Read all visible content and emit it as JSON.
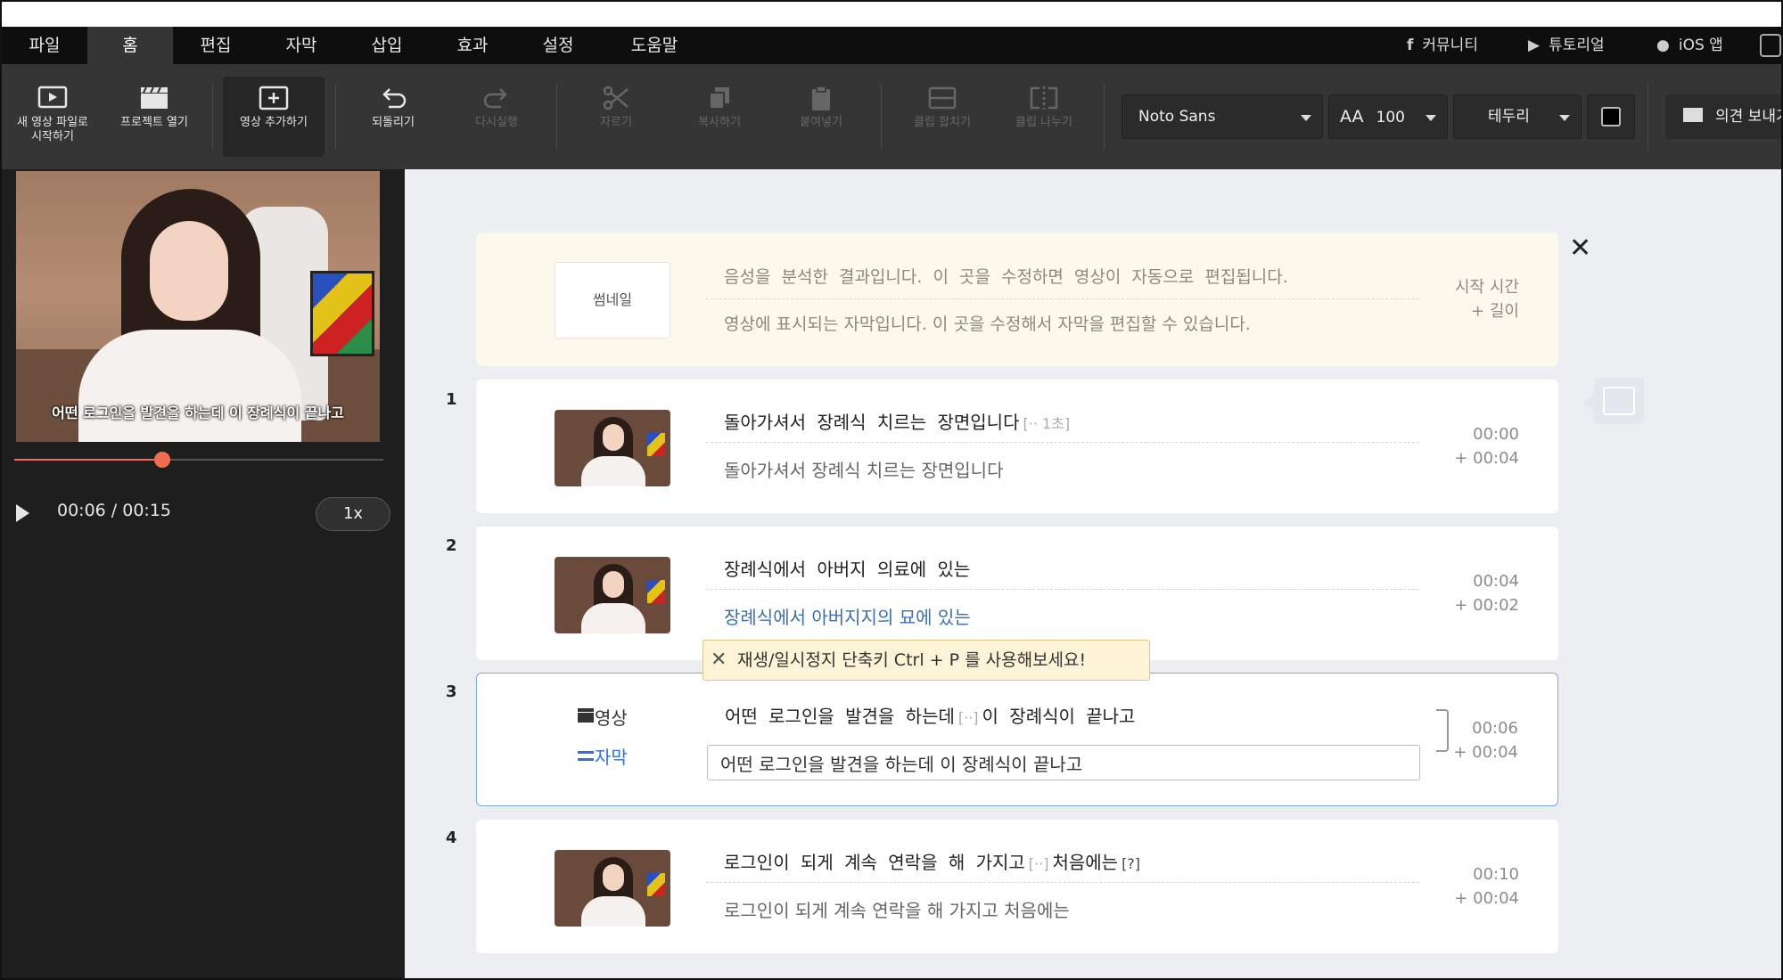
{
  "menu": {
    "tabs": [
      "파일",
      "홈",
      "편집",
      "자막",
      "삽입",
      "효과",
      "설정",
      "도움말"
    ],
    "active_index": 1,
    "links": [
      {
        "icon": "facebook-icon",
        "label": "커뮤니티"
      },
      {
        "icon": "youtube-icon",
        "label": "튜토리얼"
      },
      {
        "icon": "apple-icon",
        "label": "iOS 앱"
      }
    ]
  },
  "toolbar": {
    "buttons": [
      {
        "icon": "new-video-icon",
        "label": "새 영상 파일로\n시작하기",
        "enabled": true
      },
      {
        "icon": "clapperboard-icon",
        "label": "프로젝트 열기",
        "enabled": true
      },
      {
        "icon": "add-video-icon",
        "label": "영상 추가하기",
        "enabled": true,
        "active": true
      },
      {
        "icon": "undo-icon",
        "label": "되돌리기",
        "enabled": true
      },
      {
        "icon": "redo-icon",
        "label": "다시실행",
        "enabled": false
      },
      {
        "icon": "scissors-icon",
        "label": "자르기",
        "enabled": false
      },
      {
        "icon": "copy-icon",
        "label": "복사하기",
        "enabled": false
      },
      {
        "icon": "paste-icon",
        "label": "붙여넣기",
        "enabled": false
      },
      {
        "icon": "merge-clip-icon",
        "label": "클립 합치기",
        "enabled": false
      },
      {
        "icon": "split-clip-icon",
        "label": "클립 나누기",
        "enabled": false
      }
    ],
    "font_family": "Noto Sans",
    "font_size": "100",
    "font_size_icon": "font-size-icon",
    "outline": "테두리",
    "color": "#000000",
    "feedback_label": "의견 보내기"
  },
  "player": {
    "overlay_subtitle": "어떤 로그인을 발견을 하는데 이 장례식이 끝나고",
    "time": "00:06 / 00:15",
    "progress": 0.4,
    "speed": "1x",
    "accent": "#f26d4f"
  },
  "header": {
    "thumb_label": "썸네일",
    "line1": "음성을 분석한 결과입니다. 이 곳을 수정하면 영상이 자동으로 편집됩니다.",
    "line2": "영상에 표시되는 자막입니다. 이 곳을 수정해서 자막을 편집할 수 있습니다.",
    "time_label": "시작 시간",
    "duration_label": "+ 길이"
  },
  "clips": [
    {
      "num": "1",
      "speech": "돌아가셔서 장례식 치르는 장면입니다",
      "tag": "[·· 1초]",
      "subtitle": "돌아가셔서 장례식 치르는 장면입니다",
      "start": "00:00",
      "length": "+ 00:04"
    },
    {
      "num": "2",
      "speech": "장례식에서 아버지 의료에 있는",
      "tag": "",
      "subtitle": "장례식에서 아버지지의 묘에 있는",
      "start": "00:04",
      "length": "+ 00:02"
    },
    {
      "num": "3",
      "speech_a": "어떤 로그인을 발견을 하는데",
      "tag": "[··]",
      "speech_b": "이 장례식이 끝나고",
      "subtitle": "어떤 로그인을 발견을 하는데 이 장례식이 끝나고",
      "start": "00:06",
      "length": "+ 00:04",
      "video_label": "영상",
      "subtitle_label": "자막"
    },
    {
      "num": "4",
      "speech_a": "로그인이 되게 계속 연락을 해 가지고",
      "tag": "[··]",
      "speech_b": "처음에는",
      "tag2": "[?]",
      "subtitle": "로그인이 되게 계속 연락을 해 가지고 처음에는",
      "start": "00:10",
      "length": "+ 00:04"
    }
  ],
  "tooltip": "재생/일시정지 단축키 Ctrl + P 를 사용해보세요!"
}
